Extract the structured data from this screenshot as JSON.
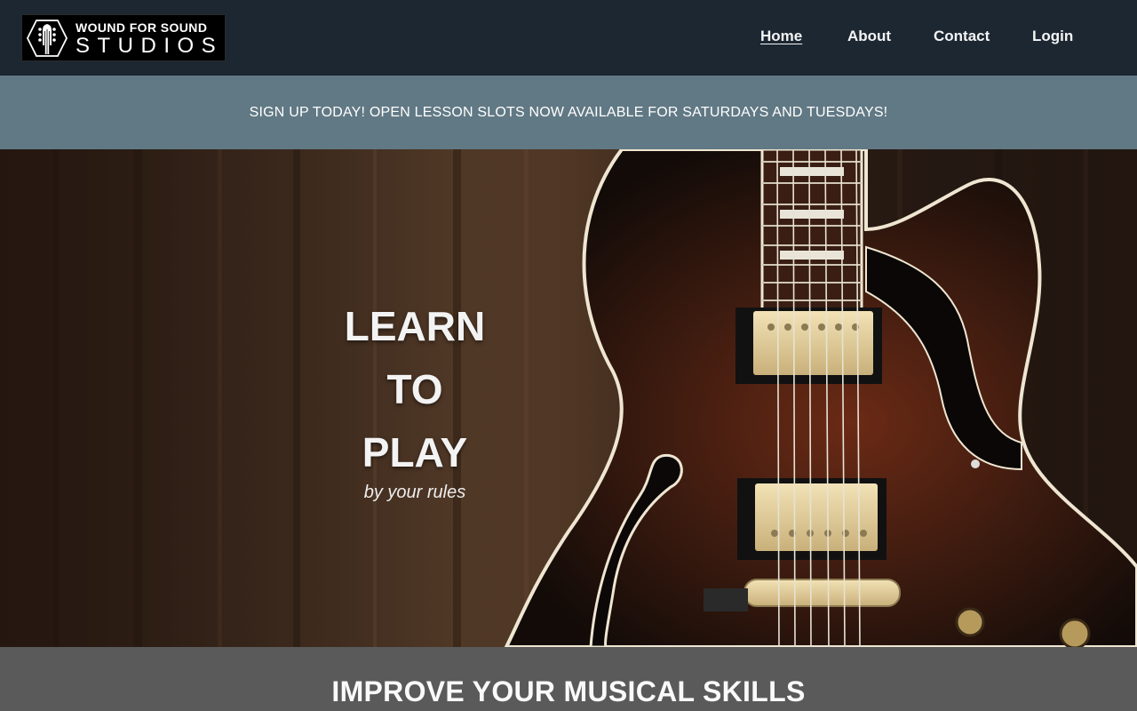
{
  "brand": {
    "line1": "WOUND FOR SOUND",
    "line2": "STUDIOS",
    "icon": "guitar-headstock-icon"
  },
  "nav": {
    "home": "Home",
    "about": "About",
    "contact": "Contact",
    "login": "Login",
    "active": "home"
  },
  "banner": {
    "text": "SIGN UP TODAY! OPEN LESSON SLOTS NOW AVAILABLE FOR SATURDAYS AND TUESDAYS!"
  },
  "hero": {
    "words": [
      "LEARN",
      "TO",
      "PLAY"
    ],
    "subtitle": "by your rules"
  },
  "section": {
    "title": "IMPROVE YOUR MUSICAL SKILLS"
  },
  "colors": {
    "header": "#1c2732",
    "banner": "#617984",
    "section": "#5a5a5a"
  }
}
